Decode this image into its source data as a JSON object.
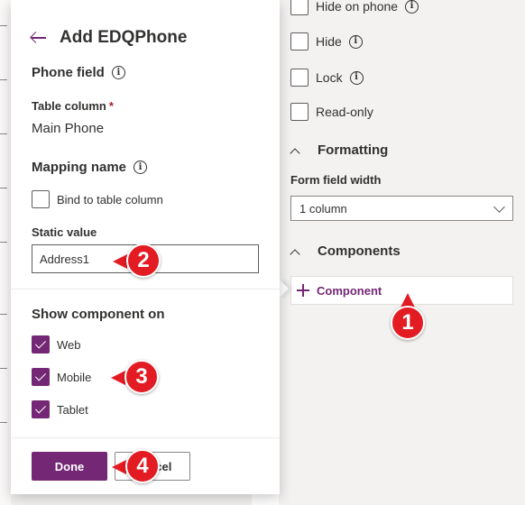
{
  "properties": {
    "hide_on_phone_label": "Hide on phone",
    "hide_label": "Hide",
    "lock_label": "Lock",
    "readonly_label": "Read-only",
    "formatting_title": "Formatting",
    "form_field_width_label": "Form field width",
    "form_field_width_value": "1 column",
    "components_title": "Components",
    "add_component_label": "Component"
  },
  "panel": {
    "title": "Add EDQPhone",
    "phone_field_title": "Phone field",
    "table_column_label": "Table column",
    "table_column_required_marker": "*",
    "table_column_value": "Main Phone",
    "mapping_name_title": "Mapping name",
    "bind_checkbox_label": "Bind to table column",
    "bind_checked": false,
    "static_value_label": "Static value",
    "static_value": "Address1",
    "show_component_title": "Show component on",
    "platforms": [
      {
        "label": "Web",
        "checked": true
      },
      {
        "label": "Mobile",
        "checked": true
      },
      {
        "label": "Tablet",
        "checked": true
      }
    ],
    "done_label": "Done",
    "cancel_label": "Cancel"
  },
  "callouts": [
    "1",
    "2",
    "3",
    "4"
  ],
  "colors": {
    "accent": "#742774",
    "callout": "#e31b23",
    "pane_bg": "#f3f2f1"
  }
}
